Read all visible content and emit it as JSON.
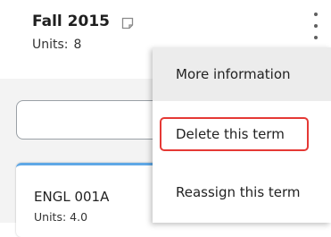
{
  "term": {
    "title": "Fall 2015",
    "units_label": "Units:",
    "units_value": "8"
  },
  "course": {
    "code": "ENGL 001A",
    "units": "Units: 4.0"
  },
  "menu": {
    "items": [
      "More information",
      "Delete this term",
      "Reassign this term"
    ],
    "highlighted_item": "Delete this term",
    "highlight_color": "#e53935"
  },
  "icons": [
    "note-icon",
    "more-vert-icon"
  ]
}
